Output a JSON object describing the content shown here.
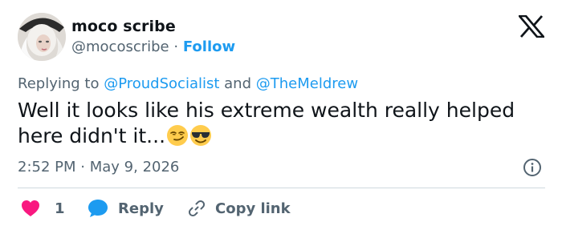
{
  "author": {
    "display_name": "moco scribe",
    "handle": "@mocoscribe",
    "separator": "·",
    "follow_label": "Follow"
  },
  "reply_context": {
    "prefix": "Replying to",
    "mention_1": "@ProudSocialist",
    "joiner": "and",
    "mention_2": "@TheMeldrew"
  },
  "tweet": {
    "text_line_1": "Well it looks like his extreme wealth really helped",
    "text_line_2": "here didn't it...",
    "emojis": [
      "smirking-face",
      "smiling-face-with-sunglasses"
    ]
  },
  "meta": {
    "time": "2:52 PM",
    "separator": "·",
    "date": "May 9, 2026"
  },
  "actions": {
    "like_count": "1",
    "reply_label": "Reply",
    "copy_label": "Copy link"
  },
  "colors": {
    "accent": "#1d9bf0",
    "like": "#f91880",
    "muted": "#536471",
    "text": "#0f1419",
    "divider": "#cfd9de"
  }
}
